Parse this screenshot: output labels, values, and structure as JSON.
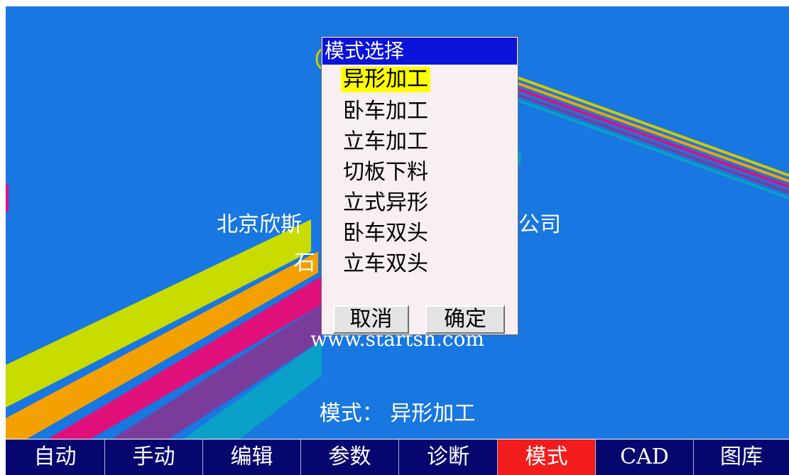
{
  "colors": {
    "panel_background": "#1877e0",
    "dialog_title_background": "#0a14d8",
    "selected_highlight": "#ffff00",
    "tabbar_background": "#06066e",
    "active_tab": "#f21c1c"
  },
  "splash": {
    "company_line1": "北京欣斯",
    "company_line1_tail": "公司",
    "company_line2": "石",
    "website": "www.startsh.com",
    "mode_label": "模式：",
    "mode_value": "异形加工"
  },
  "dialog": {
    "title": "模式选择",
    "options": [
      "异形加工",
      "卧车加工",
      "立车加工",
      "切板下料",
      "立式异形",
      "卧车双头",
      "立车双头"
    ],
    "selected_option": "异形加工",
    "cancel_label": "取消",
    "ok_label": "确定"
  },
  "tabs": [
    {
      "label": "自动"
    },
    {
      "label": "手动"
    },
    {
      "label": "编辑"
    },
    {
      "label": "参数"
    },
    {
      "label": "诊断"
    },
    {
      "label": "模式",
      "active": true
    },
    {
      "label": "CAD"
    },
    {
      "label": "图库"
    }
  ]
}
